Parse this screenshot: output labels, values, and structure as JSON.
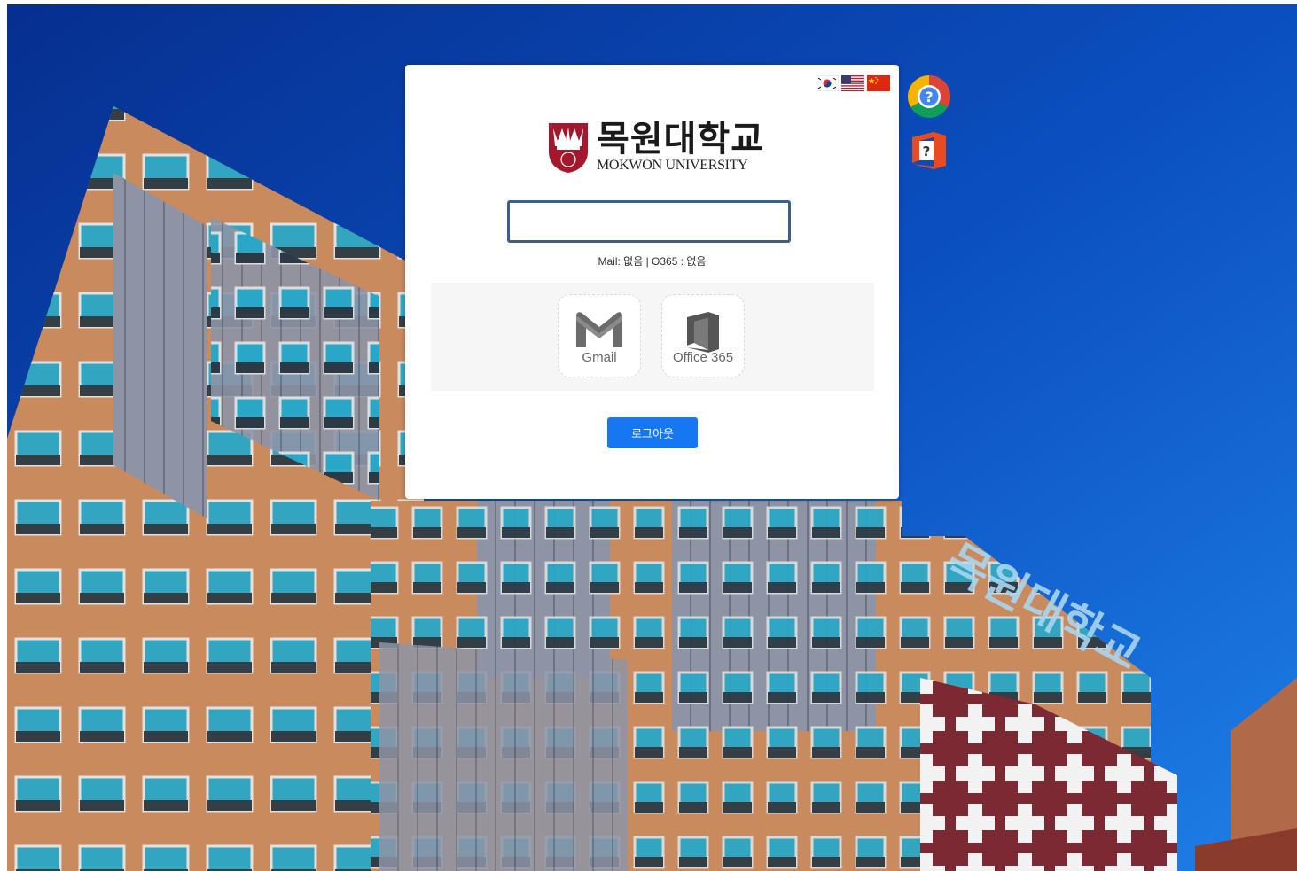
{
  "header": {
    "languages": [
      {
        "name": "korean",
        "icon": "flag-korea-icon"
      },
      {
        "name": "english",
        "icon": "flag-usa-icon"
      },
      {
        "name": "chinese",
        "icon": "flag-china-icon"
      }
    ]
  },
  "brand": {
    "name_ko": "목원대학교",
    "name_en": "MOKWON UNIVERSITY",
    "emblem_color": "#a3182c"
  },
  "login": {
    "id_value": "",
    "status_text": "Mail: 없음 | O365 : 없음"
  },
  "services": [
    {
      "label": "Gmail",
      "icon": "gmail-icon"
    },
    {
      "label": "Office 365",
      "icon": "office-icon"
    }
  ],
  "actions": {
    "logout_label": "로그아웃",
    "logout_color": "#1677f2"
  },
  "help": {
    "chrome_help_icon": "chrome-help-icon",
    "office_help_icon": "office-help-icon"
  },
  "background": {
    "sky_color": "#0a4fb8",
    "sign_text": "목원대학교"
  }
}
